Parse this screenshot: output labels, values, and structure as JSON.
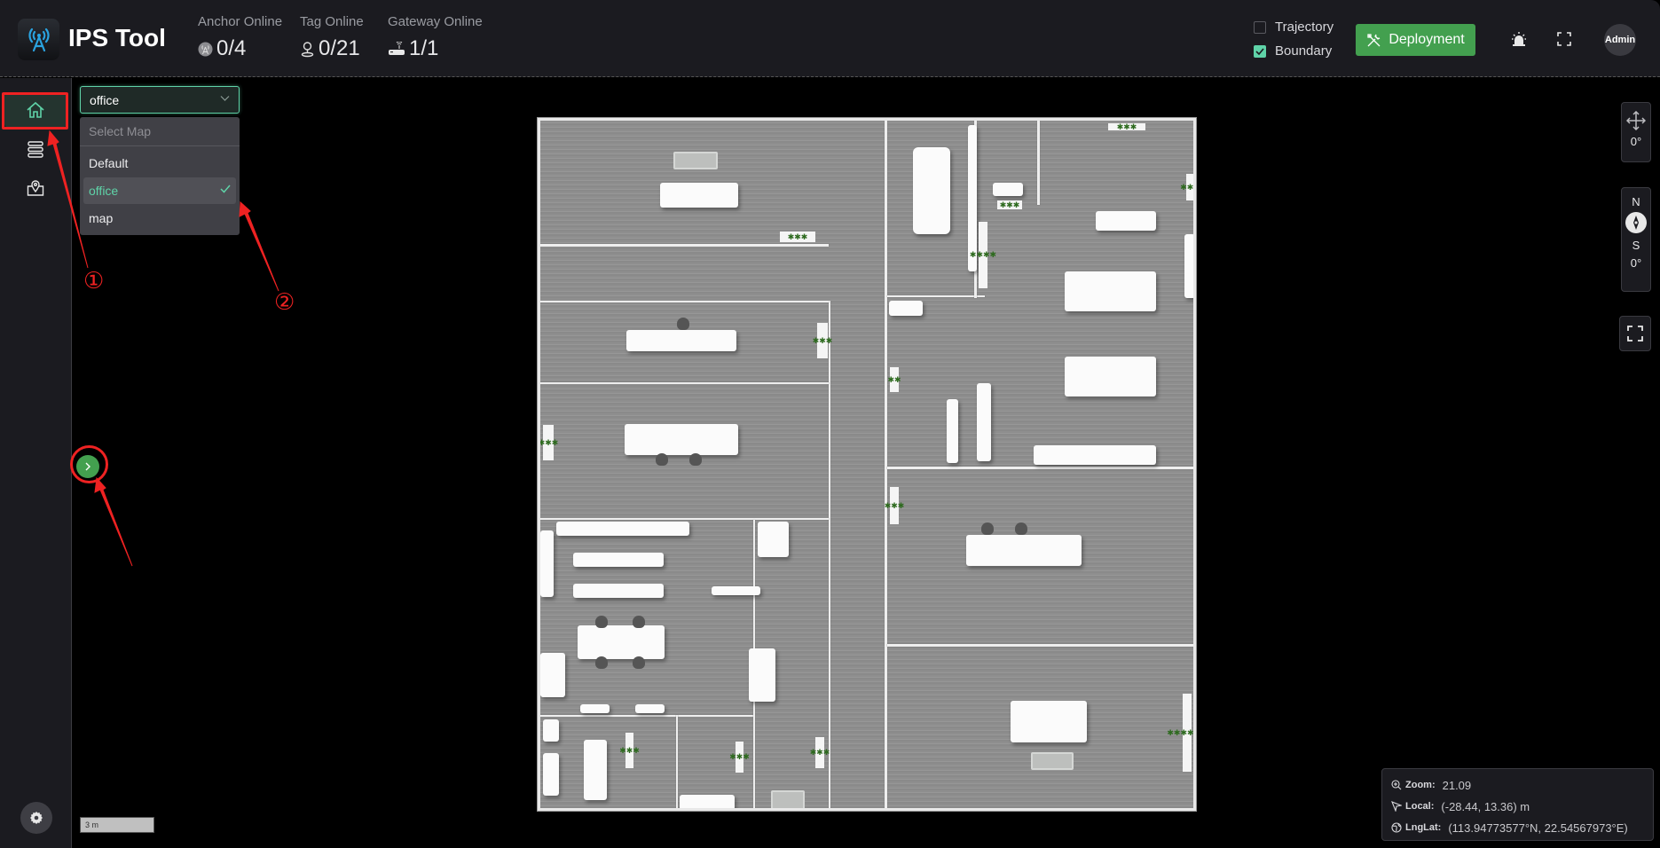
{
  "header": {
    "app_title": "IPS Tool",
    "stats": [
      {
        "label": "Anchor Online",
        "value": "0/4",
        "icon": "anchor-icon"
      },
      {
        "label": "Tag Online",
        "value": "0/21",
        "icon": "tag-pin-icon"
      },
      {
        "label": "Gateway Online",
        "value": "1/1",
        "icon": "gateway-router-icon"
      }
    ],
    "toggles": [
      {
        "label": "Trajectory",
        "checked": false
      },
      {
        "label": "Boundary",
        "checked": true
      }
    ],
    "deploy_label": "Deployment",
    "avatar_label": "Admin"
  },
  "sidebar": {
    "items": [
      {
        "name": "home",
        "icon": "home-icon",
        "active": true
      },
      {
        "name": "list",
        "icon": "list-icon",
        "active": false
      },
      {
        "name": "map-pin",
        "icon": "map-pin-icon",
        "active": false
      }
    ],
    "settings_icon": "gear-icon"
  },
  "map_select": {
    "value": "office",
    "dropdown_header": "Select Map",
    "options": [
      {
        "label": "Default",
        "selected": false
      },
      {
        "label": "office",
        "selected": true
      },
      {
        "label": "map",
        "selected": false
      }
    ]
  },
  "scale_bar": {
    "label": "3 m"
  },
  "controls": {
    "rotation_angle": "0°",
    "compass_north": "N",
    "compass_south": "S",
    "compass_angle": "0°"
  },
  "info_panel": {
    "zoom_label": "Zoom:",
    "zoom_value": "21.09",
    "local_label": "Local:",
    "local_value": "(-28.44,  13.36)  m",
    "lnglat_label": "LngLat:",
    "lnglat_value": "(113.94773577°N,  22.54567973°E)"
  },
  "annotations": {
    "marker_1": "①",
    "marker_2": "②",
    "color": "#ee2222"
  },
  "colors": {
    "accent": "#5fd3a8",
    "deploy_green": "#43a04f",
    "header_bg": "#1b1b20"
  }
}
